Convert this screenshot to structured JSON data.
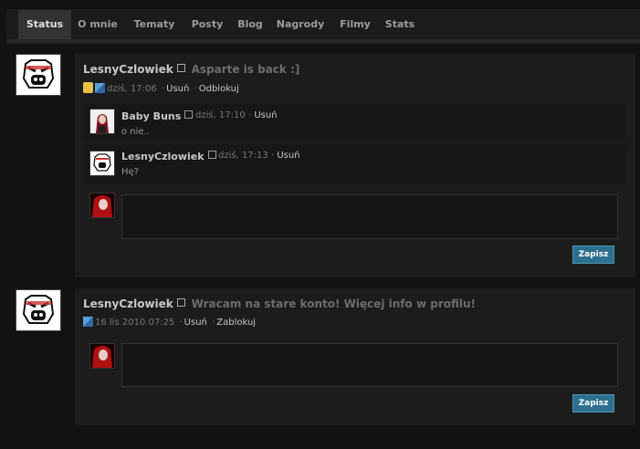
{
  "tabs": [
    {
      "label": "Status",
      "active": true
    },
    {
      "label": "O mnie"
    },
    {
      "label": "Tematy"
    },
    {
      "label": "Posty"
    },
    {
      "label": "Blog"
    },
    {
      "label": "Nagrody"
    },
    {
      "label": "Filmy"
    },
    {
      "label": "Stats"
    }
  ],
  "statuses": [
    {
      "user": "LesnyCzlowiek",
      "text": "Asparte is back :]",
      "time": "dziś, 17:06",
      "actions": [
        "Usuń",
        "Odblokuj"
      ],
      "icons": [
        "lock-icon",
        "conversation-icon"
      ],
      "comments": [
        {
          "user": "Baby Buns",
          "time": "dziś, 17:10",
          "action": "Usuń",
          "text": "o nie.."
        },
        {
          "user": "LesnyCzlowiek",
          "time": "dziś, 17:13",
          "action": "Usuń",
          "text": "Hę?"
        }
      ],
      "save_label": "Zapisz"
    },
    {
      "user": "LesnyCzlowiek",
      "text": "Wracam na stare konto! Więcej info w profilu!",
      "time": "16 lis 2010 07:25",
      "actions": [
        "Usuń",
        "Zablokuj"
      ],
      "icons": [
        "conversation-icon"
      ],
      "comments": [],
      "save_label": "Zapisz"
    }
  ],
  "colors": {
    "background": "#121212",
    "panel": "#1c1c1c",
    "button": "#2c6f8e"
  }
}
